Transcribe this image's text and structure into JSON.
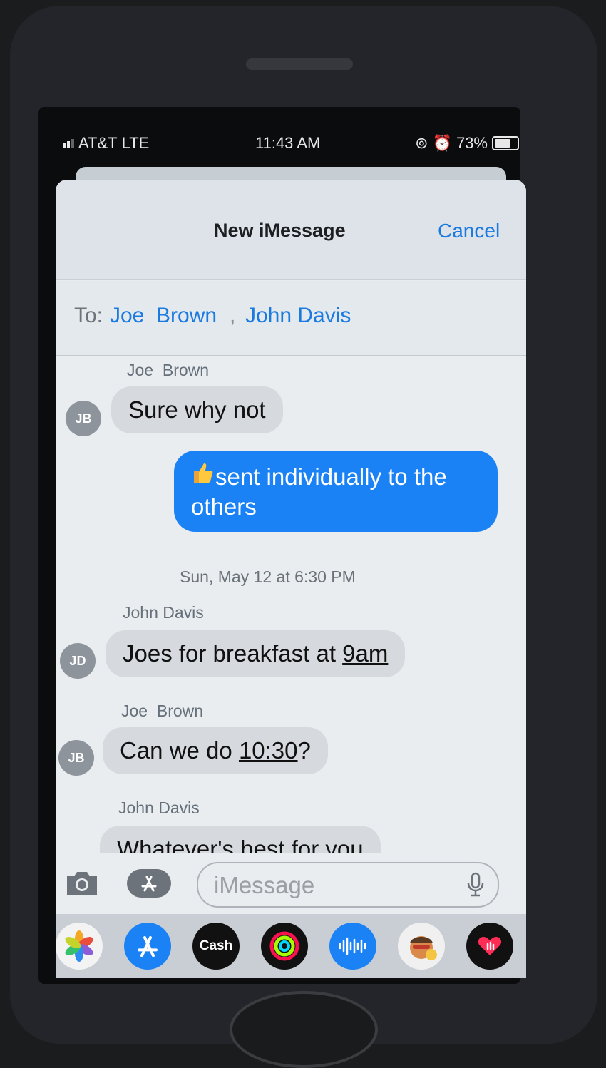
{
  "status": {
    "carrier": "AT&T",
    "network": "LTE",
    "time": "11:43 AM",
    "battery": "73%"
  },
  "header": {
    "title": "New iMessage",
    "cancel_label": "Cancel"
  },
  "to": {
    "label": "To:",
    "recipient_1": "Joe  Brown",
    "separator": ",",
    "recipient_2": "John Davis"
  },
  "messages": [
    {
      "sender": "Joe  Brown",
      "initials": "JB",
      "text": "Sure why not"
    },
    {
      "text": "sent individually to the others"
    },
    {
      "sender": "John Davis",
      "initials": "JD",
      "text_before": "Joes for breakfast at ",
      "link": "9am"
    },
    {
      "sender": "Joe  Brown",
      "initials": "JB",
      "text_before": "Can we do ",
      "link": "10:30",
      "text_after": "?"
    },
    {
      "sender": "John Davis",
      "text": "Whatever's best for you"
    }
  ],
  "timestamp": {
    "day": "Sun, May 12",
    "at": " at ",
    "time": "6:30 PM"
  },
  "compose": {
    "placeholder": "iMessage"
  },
  "app_drawer": {
    "cash_label": "Cash"
  },
  "colors": {
    "accent": "#1a7ae0",
    "outgoing_bubble": "#1a82f5",
    "incoming_bubble": "#d6dadf"
  },
  "icons": [
    "camera-icon",
    "app-store-icon",
    "microphone-icon",
    "photos-icon",
    "apple-cash-icon",
    "activity-icon",
    "audio-message-icon",
    "memoji-icon",
    "digital-touch-icon"
  ]
}
